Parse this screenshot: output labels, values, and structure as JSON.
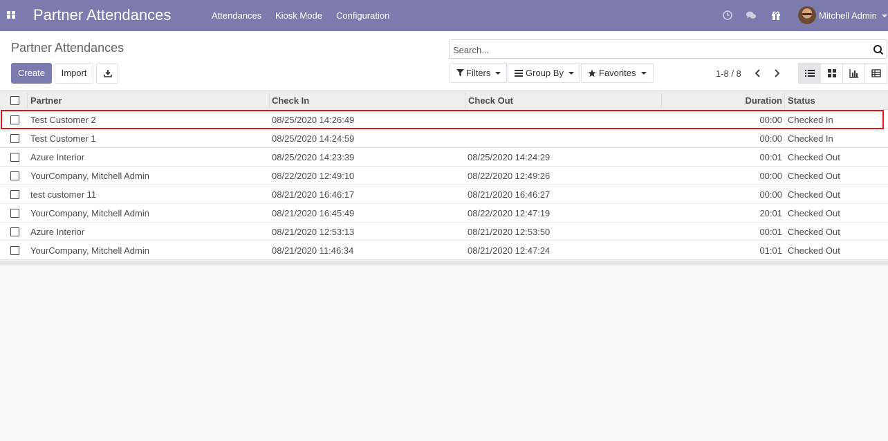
{
  "navbar": {
    "app_title": "Partner Attendances",
    "menu": [
      "Attendances",
      "Kiosk Mode",
      "Configuration"
    ],
    "user_name": "Mitchell Admin"
  },
  "control_panel": {
    "breadcrumb": "Partner Attendances",
    "create_label": "Create",
    "import_label": "Import",
    "search_placeholder": "Search...",
    "filters_label": "Filters",
    "group_by_label": "Group By",
    "favorites_label": "Favorites",
    "pager": "1-8 / 8"
  },
  "table": {
    "columns": [
      "Partner",
      "Check In",
      "Check Out",
      "Duration",
      "Status"
    ],
    "rows": [
      {
        "partner": "Test Customer 2",
        "check_in": "08/25/2020 14:26:49",
        "check_out": "",
        "duration": "00:00",
        "status": "Checked In"
      },
      {
        "partner": "Test Customer 1",
        "check_in": "08/25/2020 14:24:59",
        "check_out": "",
        "duration": "00:00",
        "status": "Checked In"
      },
      {
        "partner": "Azure Interior",
        "check_in": "08/25/2020 14:23:39",
        "check_out": "08/25/2020 14:24:29",
        "duration": "00:01",
        "status": "Checked Out"
      },
      {
        "partner": "YourCompany, Mitchell Admin",
        "check_in": "08/22/2020 12:49:10",
        "check_out": "08/22/2020 12:49:26",
        "duration": "00:00",
        "status": "Checked Out"
      },
      {
        "partner": "test customer 11",
        "check_in": "08/21/2020 16:46:17",
        "check_out": "08/21/2020 16:46:27",
        "duration": "00:00",
        "status": "Checked Out"
      },
      {
        "partner": "YourCompany, Mitchell Admin",
        "check_in": "08/21/2020 16:45:49",
        "check_out": "08/22/2020 12:47:19",
        "duration": "20:01",
        "status": "Checked Out"
      },
      {
        "partner": "Azure Interior",
        "check_in": "08/21/2020 12:53:13",
        "check_out": "08/21/2020 12:53:50",
        "duration": "00:01",
        "status": "Checked Out"
      },
      {
        "partner": "YourCompany, Mitchell Admin",
        "check_in": "08/21/2020 11:46:34",
        "check_out": "08/21/2020 12:47:24",
        "duration": "01:01",
        "status": "Checked Out"
      }
    ]
  },
  "icons": {
    "apps": "apps-grid-icon",
    "activity": "clock-icon",
    "discuss": "chat-bubbles-icon",
    "gift": "gift-icon",
    "download": "download-icon",
    "search": "search-icon",
    "filter": "filter-icon",
    "group": "list-lines-icon",
    "favorites": "star-icon",
    "views": [
      "list-view-icon",
      "kanban-view-icon",
      "graph-view-icon",
      "pivot-view-icon"
    ]
  },
  "colors": {
    "brand": "#7c7bad",
    "highlight": "#e8131a"
  }
}
